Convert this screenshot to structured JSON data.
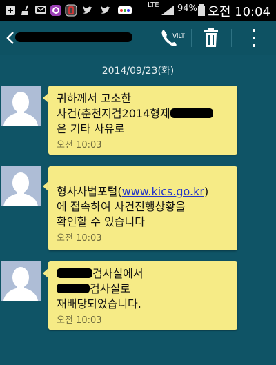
{
  "status_bar": {
    "network": "LTE",
    "battery": "94%",
    "time": "오전 10:04"
  },
  "action_bar": {
    "call_label": "ViLTE"
  },
  "conversation": {
    "date": "2014/09/23(화)",
    "messages": [
      {
        "lines": [
          "귀하께서 고소한",
          "사건(춘천지검2014형제",
          "은 기타 사유로"
        ],
        "time": "오전 10:03"
      },
      {
        "lines": [
          "형사사법포털(",
          "www.kics.go.kr",
          ")",
          "에 접속하여 사건진행상황을",
          "확인할 수 있습니다"
        ],
        "time": "오전 10:03"
      },
      {
        "lines": [
          "검사실에서",
          "검사실로",
          "재배당되었습니다."
        ],
        "time": "오전 10:03"
      }
    ]
  },
  "colors": {
    "background": "#0f5466",
    "bubble": "#f6eb86",
    "link": "#2436c8"
  }
}
